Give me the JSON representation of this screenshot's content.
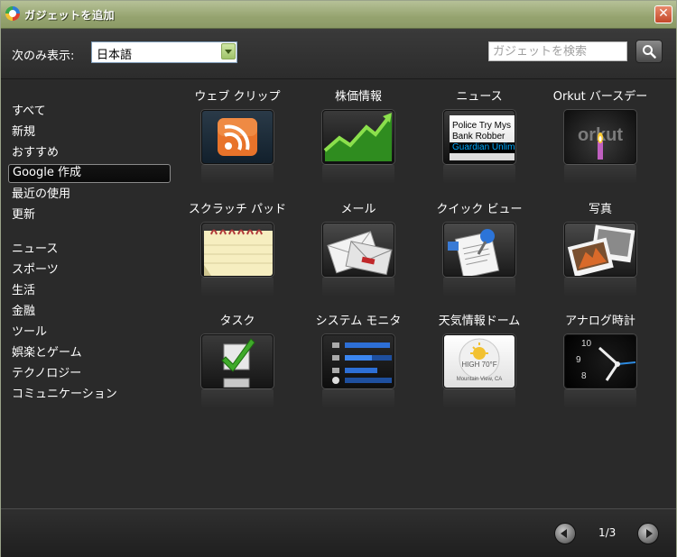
{
  "window": {
    "title": "ガジェットを追加",
    "close_label": "✕"
  },
  "filter": {
    "label": "次のみ表示:",
    "language_value": "日本語"
  },
  "search": {
    "placeholder": "ガジェットを検索"
  },
  "categories": [
    {
      "label": "すべて",
      "selected": false
    },
    {
      "label": "新規",
      "selected": false
    },
    {
      "label": "おすすめ",
      "selected": false
    },
    {
      "label": "Google 作成",
      "selected": true
    },
    {
      "label": "最近の使用",
      "selected": false
    },
    {
      "label": "更新",
      "selected": false
    },
    {
      "label": "ニュース",
      "selected": false
    },
    {
      "label": "スポーツ",
      "selected": false
    },
    {
      "label": "生活",
      "selected": false
    },
    {
      "label": "金融",
      "selected": false
    },
    {
      "label": "ツール",
      "selected": false
    },
    {
      "label": "娯楽とゲーム",
      "selected": false
    },
    {
      "label": "テクノロジー",
      "selected": false
    },
    {
      "label": "コミュニケーション",
      "selected": false
    }
  ],
  "gadgets": [
    {
      "label": "ウェブ クリップ",
      "icon": "rss-icon"
    },
    {
      "label": "株価情報",
      "icon": "stock-chart-icon"
    },
    {
      "label": "ニュース",
      "icon": "news-icon",
      "preview_lines": [
        "Police Try Mys",
        "Bank Robber",
        "Guardian Unlim"
      ]
    },
    {
      "label": "Orkut バースデー",
      "icon": "orkut-cake-icon",
      "logo_text": "orkut"
    },
    {
      "label": "スクラッチ パッド",
      "icon": "notepad-icon"
    },
    {
      "label": "メール",
      "icon": "mail-icon"
    },
    {
      "label": "クイック ビュー",
      "icon": "quick-view-icon"
    },
    {
      "label": "写真",
      "icon": "photos-icon"
    },
    {
      "label": "タスク",
      "icon": "tasks-checkbox-icon"
    },
    {
      "label": "システム モニタ",
      "icon": "system-monitor-icon"
    },
    {
      "label": "天気情報ドーム",
      "icon": "weather-globe-icon",
      "preview_lines": [
        "HIGH 70°F",
        "Mountain View, CA"
      ]
    },
    {
      "label": "アナログ時計",
      "icon": "analog-clock-icon",
      "clock_numbers": [
        "10",
        "9",
        "8"
      ]
    }
  ],
  "pagination": {
    "current": 1,
    "total": 3,
    "label": "1/3"
  },
  "colors": {
    "titlebar": "#95a36f",
    "background": "#2b2b2b",
    "news_accent": "#00aaff",
    "check_green": "#3faa2a"
  }
}
